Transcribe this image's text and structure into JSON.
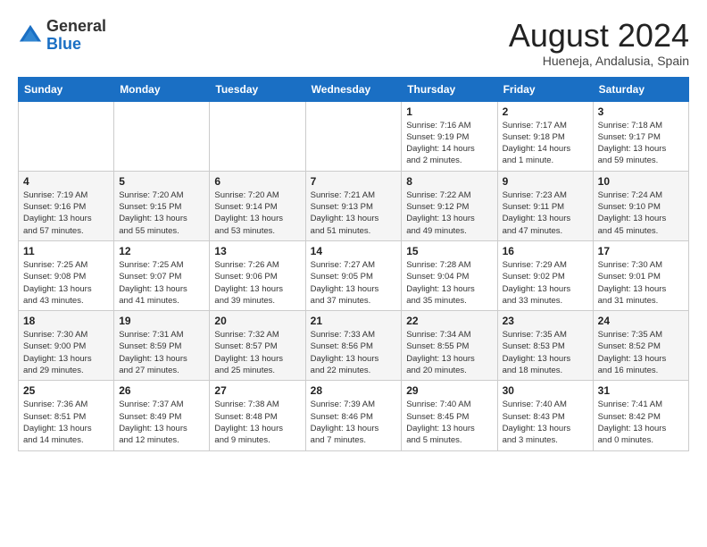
{
  "logo": {
    "general": "General",
    "blue": "Blue"
  },
  "title": {
    "month_year": "August 2024",
    "location": "Hueneja, Andalusia, Spain"
  },
  "days_of_week": [
    "Sunday",
    "Monday",
    "Tuesday",
    "Wednesday",
    "Thursday",
    "Friday",
    "Saturday"
  ],
  "weeks": [
    [
      {
        "day": "",
        "info": ""
      },
      {
        "day": "",
        "info": ""
      },
      {
        "day": "",
        "info": ""
      },
      {
        "day": "",
        "info": ""
      },
      {
        "day": "1",
        "info": "Sunrise: 7:16 AM\nSunset: 9:19 PM\nDaylight: 14 hours\nand 2 minutes."
      },
      {
        "day": "2",
        "info": "Sunrise: 7:17 AM\nSunset: 9:18 PM\nDaylight: 14 hours\nand 1 minute."
      },
      {
        "day": "3",
        "info": "Sunrise: 7:18 AM\nSunset: 9:17 PM\nDaylight: 13 hours\nand 59 minutes."
      }
    ],
    [
      {
        "day": "4",
        "info": "Sunrise: 7:19 AM\nSunset: 9:16 PM\nDaylight: 13 hours\nand 57 minutes."
      },
      {
        "day": "5",
        "info": "Sunrise: 7:20 AM\nSunset: 9:15 PM\nDaylight: 13 hours\nand 55 minutes."
      },
      {
        "day": "6",
        "info": "Sunrise: 7:20 AM\nSunset: 9:14 PM\nDaylight: 13 hours\nand 53 minutes."
      },
      {
        "day": "7",
        "info": "Sunrise: 7:21 AM\nSunset: 9:13 PM\nDaylight: 13 hours\nand 51 minutes."
      },
      {
        "day": "8",
        "info": "Sunrise: 7:22 AM\nSunset: 9:12 PM\nDaylight: 13 hours\nand 49 minutes."
      },
      {
        "day": "9",
        "info": "Sunrise: 7:23 AM\nSunset: 9:11 PM\nDaylight: 13 hours\nand 47 minutes."
      },
      {
        "day": "10",
        "info": "Sunrise: 7:24 AM\nSunset: 9:10 PM\nDaylight: 13 hours\nand 45 minutes."
      }
    ],
    [
      {
        "day": "11",
        "info": "Sunrise: 7:25 AM\nSunset: 9:08 PM\nDaylight: 13 hours\nand 43 minutes."
      },
      {
        "day": "12",
        "info": "Sunrise: 7:25 AM\nSunset: 9:07 PM\nDaylight: 13 hours\nand 41 minutes."
      },
      {
        "day": "13",
        "info": "Sunrise: 7:26 AM\nSunset: 9:06 PM\nDaylight: 13 hours\nand 39 minutes."
      },
      {
        "day": "14",
        "info": "Sunrise: 7:27 AM\nSunset: 9:05 PM\nDaylight: 13 hours\nand 37 minutes."
      },
      {
        "day": "15",
        "info": "Sunrise: 7:28 AM\nSunset: 9:04 PM\nDaylight: 13 hours\nand 35 minutes."
      },
      {
        "day": "16",
        "info": "Sunrise: 7:29 AM\nSunset: 9:02 PM\nDaylight: 13 hours\nand 33 minutes."
      },
      {
        "day": "17",
        "info": "Sunrise: 7:30 AM\nSunset: 9:01 PM\nDaylight: 13 hours\nand 31 minutes."
      }
    ],
    [
      {
        "day": "18",
        "info": "Sunrise: 7:30 AM\nSunset: 9:00 PM\nDaylight: 13 hours\nand 29 minutes."
      },
      {
        "day": "19",
        "info": "Sunrise: 7:31 AM\nSunset: 8:59 PM\nDaylight: 13 hours\nand 27 minutes."
      },
      {
        "day": "20",
        "info": "Sunrise: 7:32 AM\nSunset: 8:57 PM\nDaylight: 13 hours\nand 25 minutes."
      },
      {
        "day": "21",
        "info": "Sunrise: 7:33 AM\nSunset: 8:56 PM\nDaylight: 13 hours\nand 22 minutes."
      },
      {
        "day": "22",
        "info": "Sunrise: 7:34 AM\nSunset: 8:55 PM\nDaylight: 13 hours\nand 20 minutes."
      },
      {
        "day": "23",
        "info": "Sunrise: 7:35 AM\nSunset: 8:53 PM\nDaylight: 13 hours\nand 18 minutes."
      },
      {
        "day": "24",
        "info": "Sunrise: 7:35 AM\nSunset: 8:52 PM\nDaylight: 13 hours\nand 16 minutes."
      }
    ],
    [
      {
        "day": "25",
        "info": "Sunrise: 7:36 AM\nSunset: 8:51 PM\nDaylight: 13 hours\nand 14 minutes."
      },
      {
        "day": "26",
        "info": "Sunrise: 7:37 AM\nSunset: 8:49 PM\nDaylight: 13 hours\nand 12 minutes."
      },
      {
        "day": "27",
        "info": "Sunrise: 7:38 AM\nSunset: 8:48 PM\nDaylight: 13 hours\nand 9 minutes."
      },
      {
        "day": "28",
        "info": "Sunrise: 7:39 AM\nSunset: 8:46 PM\nDaylight: 13 hours\nand 7 minutes."
      },
      {
        "day": "29",
        "info": "Sunrise: 7:40 AM\nSunset: 8:45 PM\nDaylight: 13 hours\nand 5 minutes."
      },
      {
        "day": "30",
        "info": "Sunrise: 7:40 AM\nSunset: 8:43 PM\nDaylight: 13 hours\nand 3 minutes."
      },
      {
        "day": "31",
        "info": "Sunrise: 7:41 AM\nSunset: 8:42 PM\nDaylight: 13 hours\nand 0 minutes."
      }
    ]
  ]
}
